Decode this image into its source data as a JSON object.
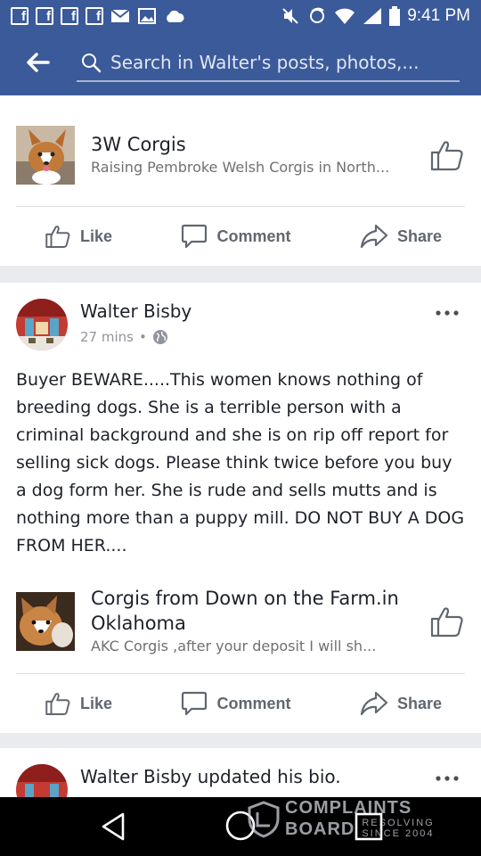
{
  "status_bar": {
    "notif_icons": [
      "facebook-icon",
      "facebook-icon",
      "facebook-icon",
      "facebook-icon",
      "mail-icon",
      "gallery-icon",
      "cloud-icon"
    ],
    "fb_glyph": "f",
    "time": "9:41 PM"
  },
  "search": {
    "placeholder": "Search in Walter's posts, photos,..."
  },
  "shared_page_1": {
    "name": "3W Corgis",
    "subtitle": "Raising Pembroke Welsh Corgis in North..."
  },
  "actions": {
    "like": "Like",
    "comment": "Comment",
    "share": "Share"
  },
  "post": {
    "author": "Walter Bisby",
    "time": "27 mins",
    "separator": "•",
    "body": "Buyer BEWARE.....This women knows nothing of breeding dogs. She is a terrible person with a criminal background and she is on rip off report for selling sick dogs. Please think twice before you buy a dog form her. She is rude and sells mutts and is nothing more than a puppy mill. DO NOT BUY A DOG FROM HER....",
    "shared_page": {
      "name": "Corgis from Down on the Farm.in Oklahoma",
      "subtitle": "AKC Corgis ,after your deposit I will sh..."
    }
  },
  "next_post": {
    "title": "Walter Bisby updated his bio."
  },
  "watermark": {
    "line1": "COMPLAINTS",
    "line2": "BOARD",
    "tag1": "RESOLVING",
    "tag2": "SINCE 2004"
  },
  "colors": {
    "brand_blue": "#3b5a9a",
    "action_gray": "#616770"
  }
}
